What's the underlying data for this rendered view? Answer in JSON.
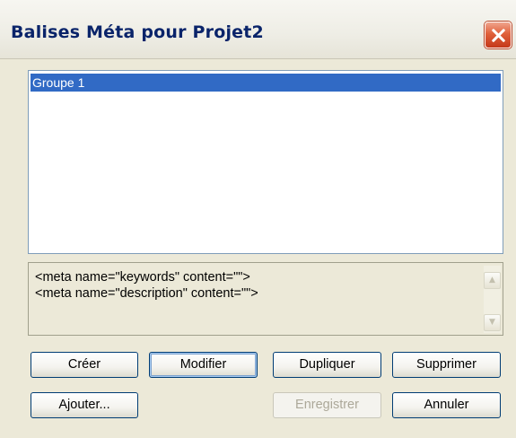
{
  "window": {
    "title": "Balises Méta pour Projet2"
  },
  "groups_list": {
    "items": [
      {
        "label": "Groupe 1",
        "selected": true
      }
    ]
  },
  "meta_preview": {
    "lines": [
      "<meta name=\"keywords\" content=\"\">",
      "<meta name=\"description\" content=\"\">"
    ]
  },
  "buttons": {
    "create": "Créer",
    "modify": "Modifier",
    "duplicate": "Dupliquer",
    "delete": "Supprimer",
    "add": "Ajouter...",
    "save": "Enregistrer",
    "cancel": "Annuler"
  },
  "icons": {
    "close": "close-icon",
    "scroll_up": "scroll-up-arrow-icon",
    "scroll_down": "scroll-down-arrow-icon"
  },
  "colors": {
    "title_text": "#0a246a",
    "selection": "#316ac5",
    "dialog_bg": "#ece9d8",
    "close_button": "#e0603a"
  },
  "state": {
    "default_button": "modify",
    "disabled_buttons": [
      "save"
    ]
  }
}
